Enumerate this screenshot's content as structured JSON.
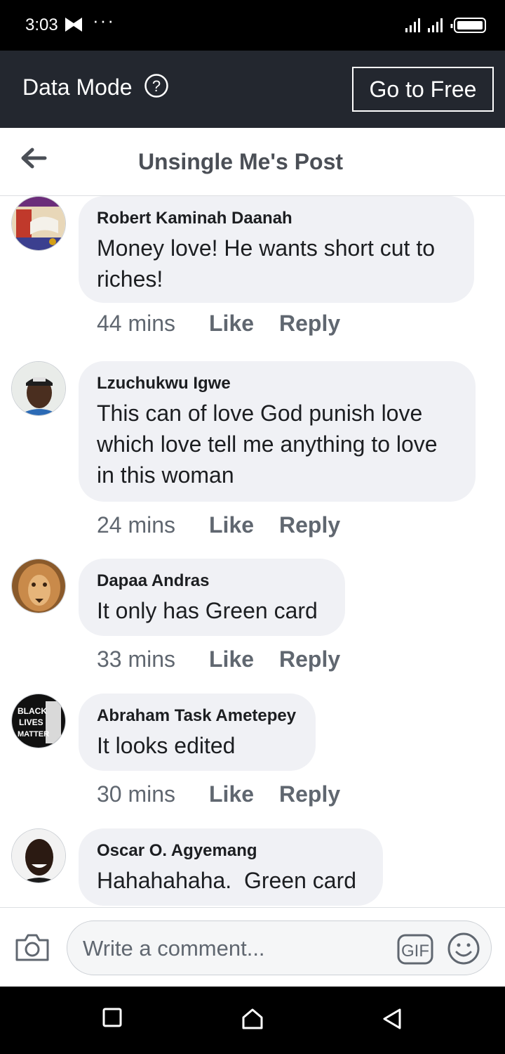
{
  "status_bar": {
    "time": "3:03",
    "more": "···"
  },
  "banner": {
    "data_mode": "Data Mode",
    "go_to_free": "Go to Free"
  },
  "header": {
    "title": "Unsingle Me's Post"
  },
  "comments": [
    {
      "author": "Robert Kaminah Daanah",
      "text": "Money love! He wants short cut to riches!",
      "time": "44 mins",
      "like": "Like",
      "reply": "Reply"
    },
    {
      "author": "Lzuchukwu Igwe",
      "text": "This can of love God punish love which love tell me anything to love in this woman",
      "time": "24 mins",
      "like": "Like",
      "reply": "Reply"
    },
    {
      "author": "Dapaa Andras",
      "text": "It only has Green card",
      "time": "33 mins",
      "like": "Like",
      "reply": "Reply"
    },
    {
      "author": "Abraham Task Ametepey",
      "text": "It looks edited",
      "time": "30 mins",
      "like": "Like",
      "reply": "Reply"
    },
    {
      "author": "Oscar O. Agyemang",
      "text": "Hahahahaha.  Green card"
    }
  ],
  "avatar_badge": {
    "line1": "BLACK",
    "line2": "LIVES",
    "line3": "MATTER"
  },
  "composer": {
    "placeholder": "Write a comment...",
    "gif": "GIF"
  }
}
